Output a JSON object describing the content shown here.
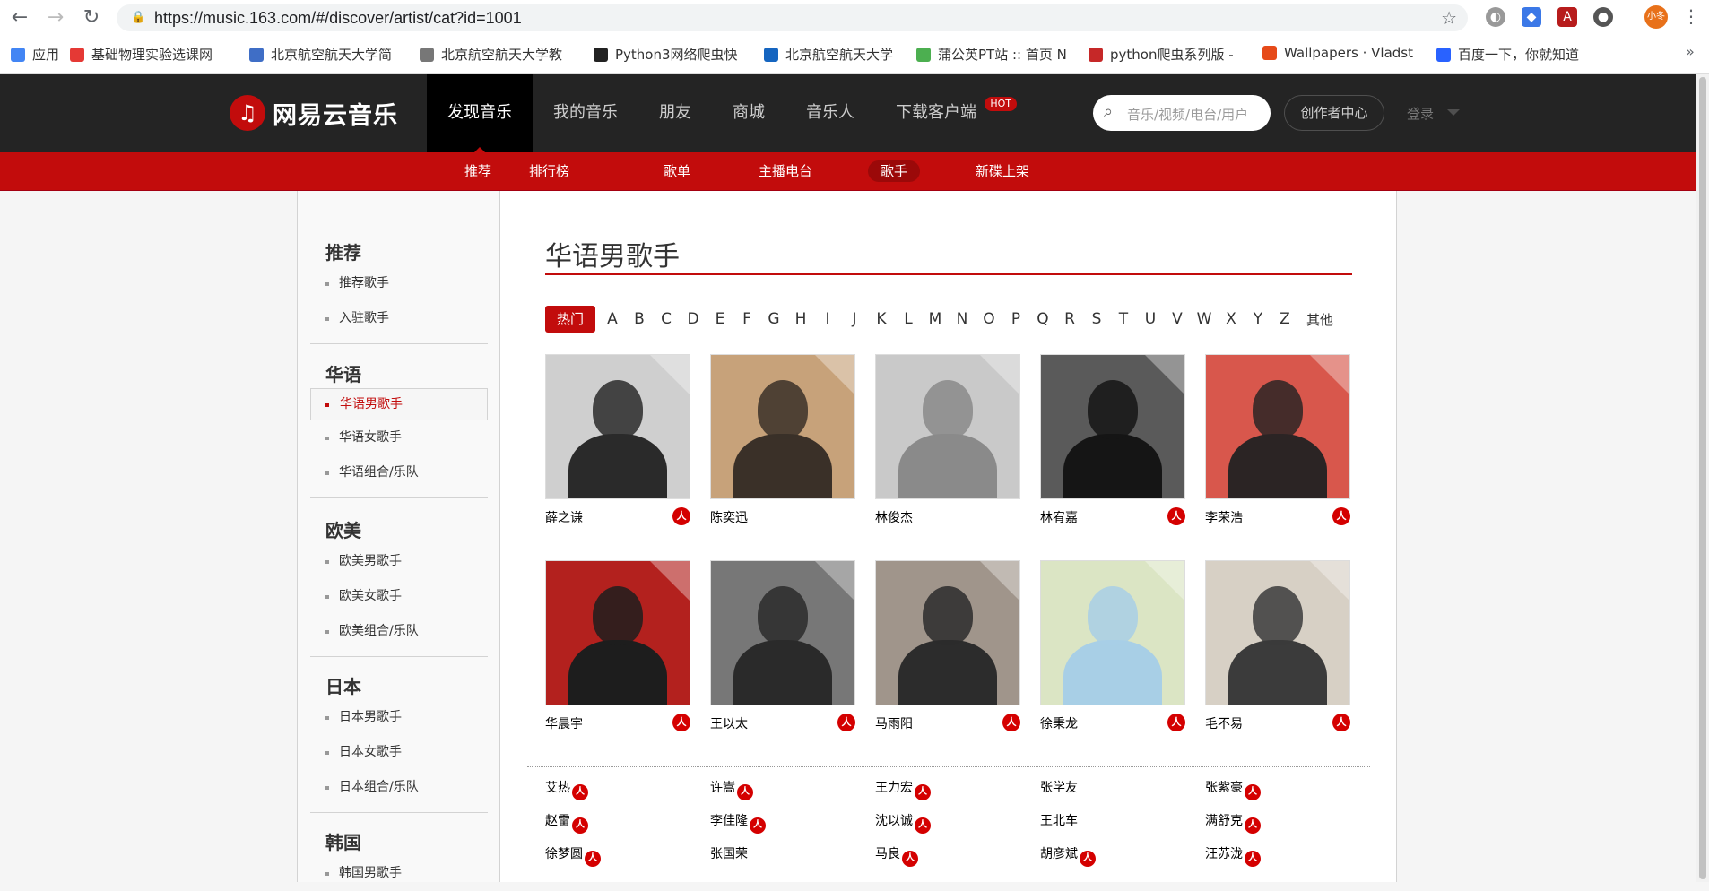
{
  "browser": {
    "url": "https://music.163.com/#/discover/artist/cat?id=1001",
    "profile_label": "小冬",
    "bookmarks": [
      {
        "label": "应用",
        "color": "#4285f4"
      },
      {
        "label": "基础物理实验选课网",
        "color": "#e53935"
      },
      {
        "label": "北京航空航天大学简",
        "color": "#3f6ec6"
      },
      {
        "label": "北京航空航天大学教",
        "color": "#777777"
      },
      {
        "label": "Python3网络爬虫快",
        "color": "#222222"
      },
      {
        "label": "北京航空航天大学",
        "color": "#1565c0"
      },
      {
        "label": "蒲公英PT站 :: 首页 N",
        "color": "#4caf50"
      },
      {
        "label": "python爬虫系列版 -",
        "color": "#c62828"
      },
      {
        "label": "Wallpapers · Vladst",
        "color": "#e64a19"
      },
      {
        "label": "百度一下，你就知道",
        "color": "#2962ff"
      }
    ]
  },
  "header": {
    "logo_text": "网易云音乐",
    "nav": [
      "发现音乐",
      "我的音乐",
      "朋友",
      "商城",
      "音乐人",
      "下载客户端"
    ],
    "hot_badge": "HOT",
    "search_placeholder": "音乐/视频/电台/用户",
    "creator_label": "创作者中心",
    "login_label": "登录"
  },
  "subnav": [
    "推荐",
    "排行榜",
    "歌单",
    "主播电台",
    "歌手",
    "新碟上架"
  ],
  "sidebar": [
    {
      "title": "推荐",
      "items": [
        "推荐歌手",
        "入驻歌手"
      ]
    },
    {
      "title": "华语",
      "items": [
        "华语男歌手",
        "华语女歌手",
        "华语组合/乐队"
      ]
    },
    {
      "title": "欧美",
      "items": [
        "欧美男歌手",
        "欧美女歌手",
        "欧美组合/乐队"
      ]
    },
    {
      "title": "日本",
      "items": [
        "日本男歌手",
        "日本女歌手",
        "日本组合/乐队"
      ]
    },
    {
      "title": "韩国",
      "items": [
        "韩国男歌手"
      ]
    }
  ],
  "main": {
    "title": "华语男歌手",
    "hot_tab": "热门",
    "letters": [
      "A",
      "B",
      "C",
      "D",
      "E",
      "F",
      "G",
      "H",
      "I",
      "J",
      "K",
      "L",
      "M",
      "N",
      "O",
      "P",
      "Q",
      "R",
      "S",
      "T",
      "U",
      "V",
      "W",
      "X",
      "Y",
      "Z"
    ],
    "other_tab": "其他",
    "verified_badge": "人",
    "artists": [
      {
        "name": "薛之谦",
        "verified": true,
        "bg": "#cfcfcf",
        "fg": "#2a2a2a"
      },
      {
        "name": "陈奕迅",
        "verified": false,
        "bg": "#c7a27a",
        "fg": "#3a3028"
      },
      {
        "name": "林俊杰",
        "verified": false,
        "bg": "#c9c9c9",
        "fg": "#8a8a8a"
      },
      {
        "name": "林宥嘉",
        "verified": true,
        "bg": "#5a5a5a",
        "fg": "#151515"
      },
      {
        "name": "李荣浩",
        "verified": true,
        "bg": "#d8574c",
        "fg": "#2b2424"
      },
      {
        "name": "华晨宇",
        "verified": true,
        "bg": "#b3211e",
        "fg": "#1d1d1d"
      },
      {
        "name": "王以太",
        "verified": true,
        "bg": "#777777",
        "fg": "#2a2a2a"
      },
      {
        "name": "马雨阳",
        "verified": true,
        "bg": "#a0958b",
        "fg": "#2c2c2c"
      },
      {
        "name": "徐秉龙",
        "verified": true,
        "bg": "#dbe5c4",
        "fg": "#a8cfe6"
      },
      {
        "name": "毛不易",
        "verified": true,
        "bg": "#d7d0c5",
        "fg": "#3b3b3b"
      }
    ],
    "name_list": [
      {
        "name": "艾热",
        "verified": true
      },
      {
        "name": "许嵩",
        "verified": true
      },
      {
        "name": "王力宏",
        "verified": true
      },
      {
        "name": "张学友",
        "verified": false
      },
      {
        "name": "张紫豪",
        "verified": true
      },
      {
        "name": "赵雷",
        "verified": true
      },
      {
        "name": "李佳隆",
        "verified": true
      },
      {
        "name": "沈以诚",
        "verified": true
      },
      {
        "name": "王北车",
        "verified": false
      },
      {
        "name": "满舒克",
        "verified": true
      },
      {
        "name": "徐梦圆",
        "verified": true
      },
      {
        "name": "张国荣",
        "verified": false
      },
      {
        "name": "马良",
        "verified": true
      },
      {
        "name": "胡彦斌",
        "verified": true
      },
      {
        "name": "汪苏泷",
        "verified": true
      }
    ]
  }
}
